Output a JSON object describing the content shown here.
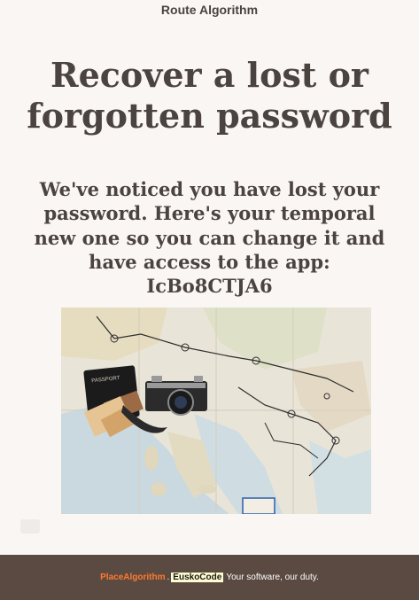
{
  "header": {
    "app_title": "Route Algorithm"
  },
  "main": {
    "heading": "Recover a lost or forgotten password",
    "message": "We've noticed you have lost your password. Here's your temporal new one so you can change it and have access to the app:",
    "temp_password": "IcBo8CTJA6",
    "photo": {
      "passport_text": "PASSPORT"
    }
  },
  "footer": {
    "brand_primary": "PlaceAlgorithm",
    "separator": ".",
    "brand_secondary": "EuskoCode",
    "tagline": "Your software, our duty."
  },
  "colors": {
    "background": "#faf6f3",
    "text": "#4a4340",
    "footer_bg": "#5a4a42",
    "brand_primary": "#ff7a2e"
  }
}
